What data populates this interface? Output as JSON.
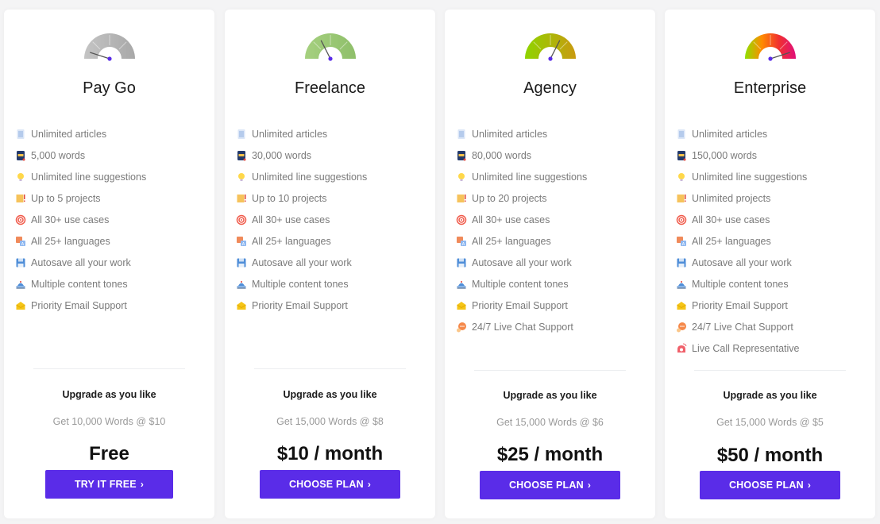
{
  "plans": [
    {
      "name": "Pay Go",
      "gauge": {
        "level": 0.1,
        "colors": [
          "#c4c4c4",
          "#a8a8a8"
        ]
      },
      "features": [
        {
          "icon": "document-icon",
          "text": "Unlimited articles"
        },
        {
          "icon": "notebook-icon",
          "text": "5,000 words"
        },
        {
          "icon": "lightbulb-icon",
          "text": "Unlimited line suggestions"
        },
        {
          "icon": "folder-icon",
          "text": "Up to 5 projects"
        },
        {
          "icon": "target-icon",
          "text": "All 30+ use cases"
        },
        {
          "icon": "language-icon",
          "text": "All 25+ languages"
        },
        {
          "icon": "floppy-disk-icon",
          "text": "Autosave all your work"
        },
        {
          "icon": "tone-icon",
          "text": "Multiple content tones"
        },
        {
          "icon": "email-icon",
          "text": "Priority Email Support"
        }
      ],
      "upgrade_title": "Upgrade as you like",
      "upgrade_offer": "Get 10,000 Words @ $10",
      "price": "Free",
      "cta_label": "TRY IT FREE",
      "cta_chevron": "›"
    },
    {
      "name": "Freelance",
      "gauge": {
        "level": 0.35,
        "colors": [
          "#a5d07f",
          "#8fbf6a"
        ]
      },
      "features": [
        {
          "icon": "document-icon",
          "text": "Unlimited articles"
        },
        {
          "icon": "notebook-icon",
          "text": "30,000 words"
        },
        {
          "icon": "lightbulb-icon",
          "text": "Unlimited line suggestions"
        },
        {
          "icon": "folder-icon",
          "text": "Up to 10 projects"
        },
        {
          "icon": "target-icon",
          "text": "All 30+ use cases"
        },
        {
          "icon": "language-icon",
          "text": "All 25+ languages"
        },
        {
          "icon": "floppy-disk-icon",
          "text": "Autosave all your work"
        },
        {
          "icon": "tone-icon",
          "text": "Multiple content tones"
        },
        {
          "icon": "email-icon",
          "text": "Priority Email Support"
        }
      ],
      "upgrade_title": "Upgrade as you like",
      "upgrade_offer": "Get 15,000 Words @ $8",
      "price": "$10 / month",
      "cta_label": "CHOOSE PLAN",
      "cta_chevron": "›"
    },
    {
      "name": "Agency",
      "gauge": {
        "level": 0.65,
        "colors": [
          "#8fd400",
          "#c99a10"
        ]
      },
      "features": [
        {
          "icon": "document-icon",
          "text": "Unlimited articles"
        },
        {
          "icon": "notebook-icon",
          "text": "80,000 words"
        },
        {
          "icon": "lightbulb-icon",
          "text": "Unlimited line suggestions"
        },
        {
          "icon": "folder-icon",
          "text": "Up to 20 projects"
        },
        {
          "icon": "target-icon",
          "text": "All 30+ use cases"
        },
        {
          "icon": "language-icon",
          "text": "All 25+ languages"
        },
        {
          "icon": "floppy-disk-icon",
          "text": "Autosave all your work"
        },
        {
          "icon": "tone-icon",
          "text": "Multiple content tones"
        },
        {
          "icon": "email-icon",
          "text": "Priority Email Support"
        },
        {
          "icon": "chat-icon",
          "text": "24/7 Live Chat Support"
        }
      ],
      "upgrade_title": "Upgrade as you like",
      "upgrade_offer": "Get 15,000 Words @ $6",
      "price": "$25 / month",
      "cta_label": "CHOOSE PLAN",
      "cta_chevron": "›"
    },
    {
      "name": "Enterprise",
      "gauge": {
        "level": 0.9,
        "colors": [
          "#8fe000",
          "#ff8a00",
          "#f03030",
          "#e0107a"
        ]
      },
      "features": [
        {
          "icon": "document-icon",
          "text": "Unlimited articles"
        },
        {
          "icon": "notebook-icon",
          "text": "150,000 words"
        },
        {
          "icon": "lightbulb-icon",
          "text": "Unlimited line suggestions"
        },
        {
          "icon": "folder-icon",
          "text": "Unlimited projects"
        },
        {
          "icon": "target-icon",
          "text": "All 30+ use cases"
        },
        {
          "icon": "language-icon",
          "text": "All 25+ languages"
        },
        {
          "icon": "floppy-disk-icon",
          "text": "Autosave all your work"
        },
        {
          "icon": "tone-icon",
          "text": "Multiple content tones"
        },
        {
          "icon": "email-icon",
          "text": "Priority Email Support"
        },
        {
          "icon": "chat-icon",
          "text": "24/7 Live Chat Support"
        },
        {
          "icon": "phone-icon",
          "text": "Live Call Representative"
        }
      ],
      "upgrade_title": "Upgrade as you like",
      "upgrade_offer": "Get 15,000 Words @ $5",
      "price": "$50 / month",
      "cta_label": "CHOOSE PLAN",
      "cta_chevron": "›"
    }
  ],
  "colors": {
    "accent": "#5a2ce8",
    "needle_dot": "#5a2ce8"
  }
}
